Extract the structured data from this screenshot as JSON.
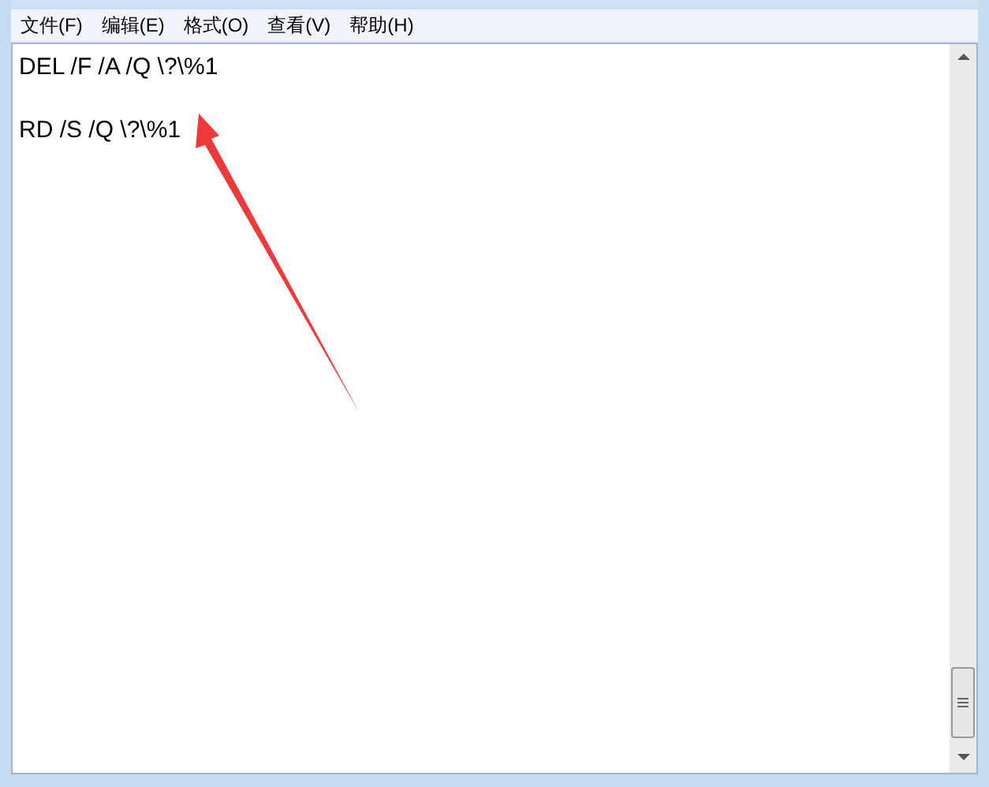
{
  "menu_bar": [
    {
      "label": "文件(F)"
    },
    {
      "label": "编辑(E)"
    },
    {
      "label": "格式(O)"
    },
    {
      "label": "查看(V)"
    },
    {
      "label": "帮助(H)"
    }
  ],
  "editor": {
    "text": "DEL /F /A /Q \\?\\%1\n\nRD /S /Q \\?\\%1"
  }
}
